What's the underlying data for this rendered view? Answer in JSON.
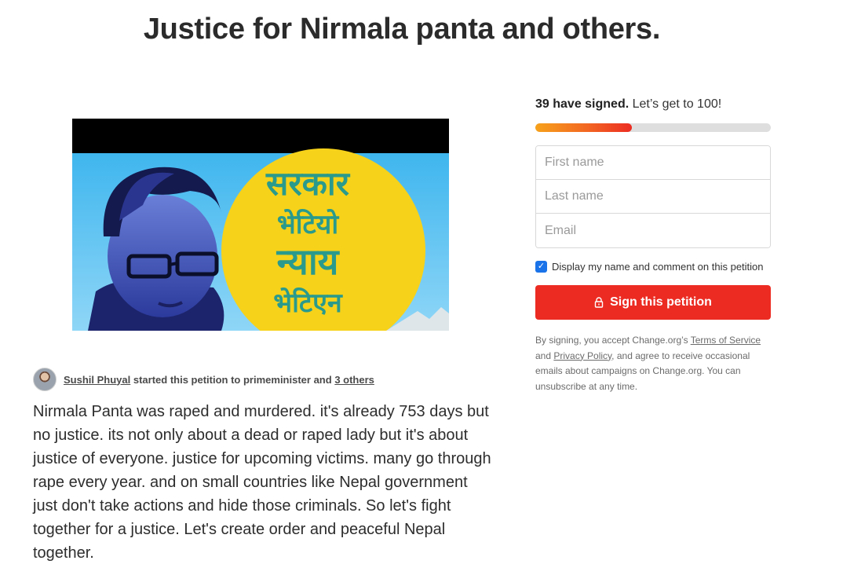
{
  "petition": {
    "title": "Justice for Nirmala panta and others.",
    "author_name": "Sushil Phuyal",
    "started_text": "started this petition to primeminister and",
    "others_link": "3 others",
    "body": "Nirmala Panta was raped and murdered. it's already 753 days but no justice. its not only about a dead or raped lady but it's about justice of everyone. justice for upcoming victims. many go through rape every year. and on small countries like Nepal government just don't take actions and hide those criminals. So let's fight together for a justice. Let's create order and peaceful Nepal together."
  },
  "image": {
    "line1": "सरकार",
    "line2": "भेटियो",
    "line3": "न्याय",
    "line4": "भेटिएन"
  },
  "progress": {
    "signed_bold": "39 have signed.",
    "goal_text": "Let’s get to 100!",
    "fraction": 0.41
  },
  "form": {
    "first_name_placeholder": "First name",
    "last_name_placeholder": "Last name",
    "email_placeholder": "Email",
    "display_checkbox_label": "Display my name and comment on this petition",
    "display_checked": true,
    "sign_button": "Sign this petition"
  },
  "legal": {
    "prefix": "By signing, you accept Change.org’s",
    "terms_link": "Terms of Service",
    "and": "and",
    "privacy_link": "Privacy Policy",
    "suffix": ", and agree to receive occasional emails about campaigns on Change.org. You can unsubscribe at any time."
  },
  "colors": {
    "sign_button": "#ec2c22",
    "progress_start": "#f7a21b",
    "progress_end": "#ec2c22",
    "checkbox": "#1a73e8",
    "image_sun": "#f7d21a"
  }
}
